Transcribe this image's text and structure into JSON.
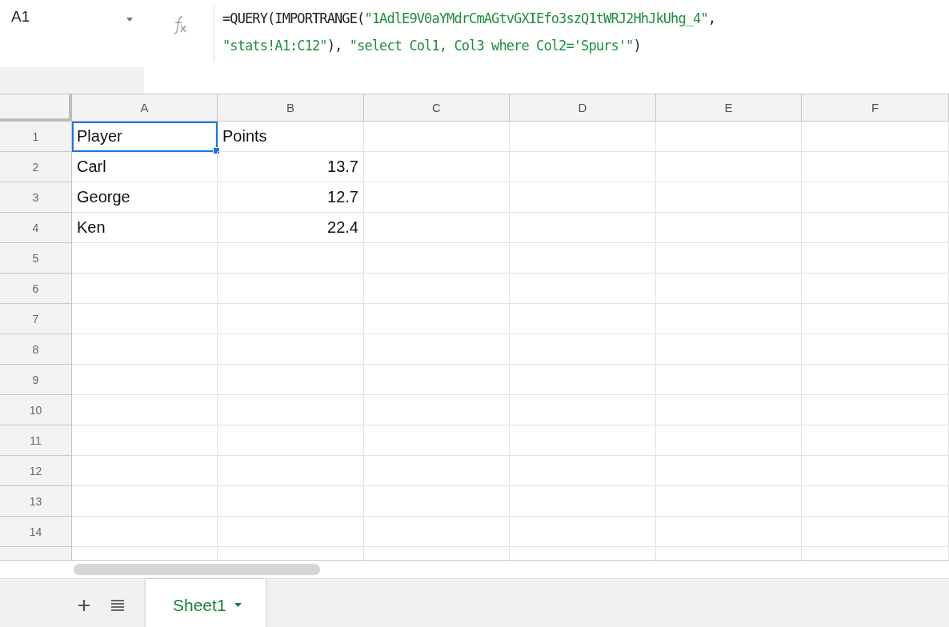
{
  "name_box": {
    "value": "A1"
  },
  "formula_bar": {
    "lines": [
      [
        {
          "kind": "plain",
          "text": "=QUERY(IMPORTRANGE("
        },
        {
          "kind": "string",
          "text": "\"1AdlE9V0aYMdrCmAGtvGXIEfo3szQ1tWRJ2HhJkUhg_4\""
        },
        {
          "kind": "plain",
          "text": ","
        }
      ],
      [
        {
          "kind": "string",
          "text": "\"stats!A1:C12\""
        },
        {
          "kind": "plain",
          "text": "), "
        },
        {
          "kind": "string",
          "text": "\"select Col1, Col3 where Col2='Spurs'\""
        },
        {
          "kind": "plain",
          "text": ")"
        }
      ]
    ]
  },
  "columns": [
    "A",
    "B",
    "C",
    "D",
    "E",
    "F"
  ],
  "rows": [
    {
      "label": "1",
      "cells": [
        {
          "text": "Player",
          "kind": "text",
          "selected": true
        },
        {
          "text": "Points",
          "kind": "text",
          "selected": false
        }
      ]
    },
    {
      "label": "2",
      "cells": [
        {
          "text": "Carl",
          "kind": "text",
          "selected": false
        },
        {
          "text": "13.7",
          "kind": "number",
          "selected": false
        }
      ]
    },
    {
      "label": "3",
      "cells": [
        {
          "text": "George",
          "kind": "text",
          "selected": false
        },
        {
          "text": "12.7",
          "kind": "number",
          "selected": false
        }
      ]
    },
    {
      "label": "4",
      "cells": [
        {
          "text": "Ken",
          "kind": "text",
          "selected": false
        },
        {
          "text": "22.4",
          "kind": "number",
          "selected": false
        }
      ]
    },
    {
      "label": "5",
      "cells": []
    },
    {
      "label": "6",
      "cells": []
    },
    {
      "label": "7",
      "cells": []
    },
    {
      "label": "8",
      "cells": []
    },
    {
      "label": "9",
      "cells": []
    },
    {
      "label": "10",
      "cells": []
    },
    {
      "label": "11",
      "cells": []
    },
    {
      "label": "12",
      "cells": []
    },
    {
      "label": "13",
      "cells": []
    },
    {
      "label": "14",
      "cells": []
    }
  ],
  "sheet_tabs": [
    {
      "label": "Sheet1",
      "selected": true
    }
  ]
}
